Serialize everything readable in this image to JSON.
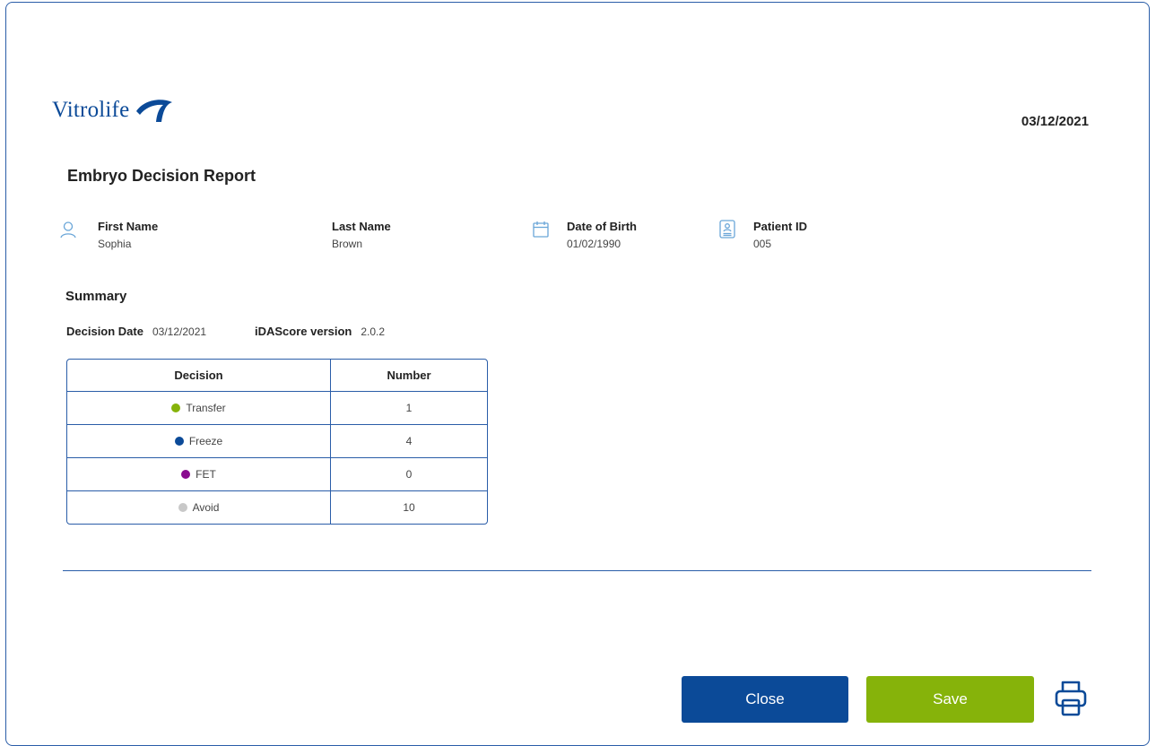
{
  "brand": {
    "name": "Vitrolife",
    "color": "#0b4a98"
  },
  "report": {
    "date": "03/12/2021",
    "title": "Embryo Decision Report"
  },
  "patient": {
    "first_name": {
      "label": "First Name",
      "value": "Sophia",
      "icon": "person-icon"
    },
    "last_name": {
      "label": "Last Name",
      "value": "Brown"
    },
    "dob": {
      "label": "Date of Birth",
      "value": "01/02/1990",
      "icon": "calendar-icon"
    },
    "patient_id": {
      "label": "Patient ID",
      "value": "005",
      "icon": "id-card-icon"
    }
  },
  "summary": {
    "title": "Summary",
    "decision_date_label": "Decision Date",
    "decision_date_value": "03/12/2021",
    "version_label": "iDAScore version",
    "version_value": "2.0.2"
  },
  "table": {
    "headers": [
      "Decision",
      "Number"
    ],
    "rows": [
      {
        "decision": "Transfer",
        "number": "1",
        "color": "#86b30a"
      },
      {
        "decision": "Freeze",
        "number": "4",
        "color": "#0b4a98"
      },
      {
        "decision": "FET",
        "number": "0",
        "color": "#8a0b8f"
      },
      {
        "decision": "Avoid",
        "number": "10",
        "color": "#c8c8c8"
      }
    ]
  },
  "actions": {
    "close_label": "Close",
    "save_label": "Save",
    "print_icon": "printer-icon",
    "close_color": "#0b4a98",
    "save_color": "#86b30a"
  }
}
